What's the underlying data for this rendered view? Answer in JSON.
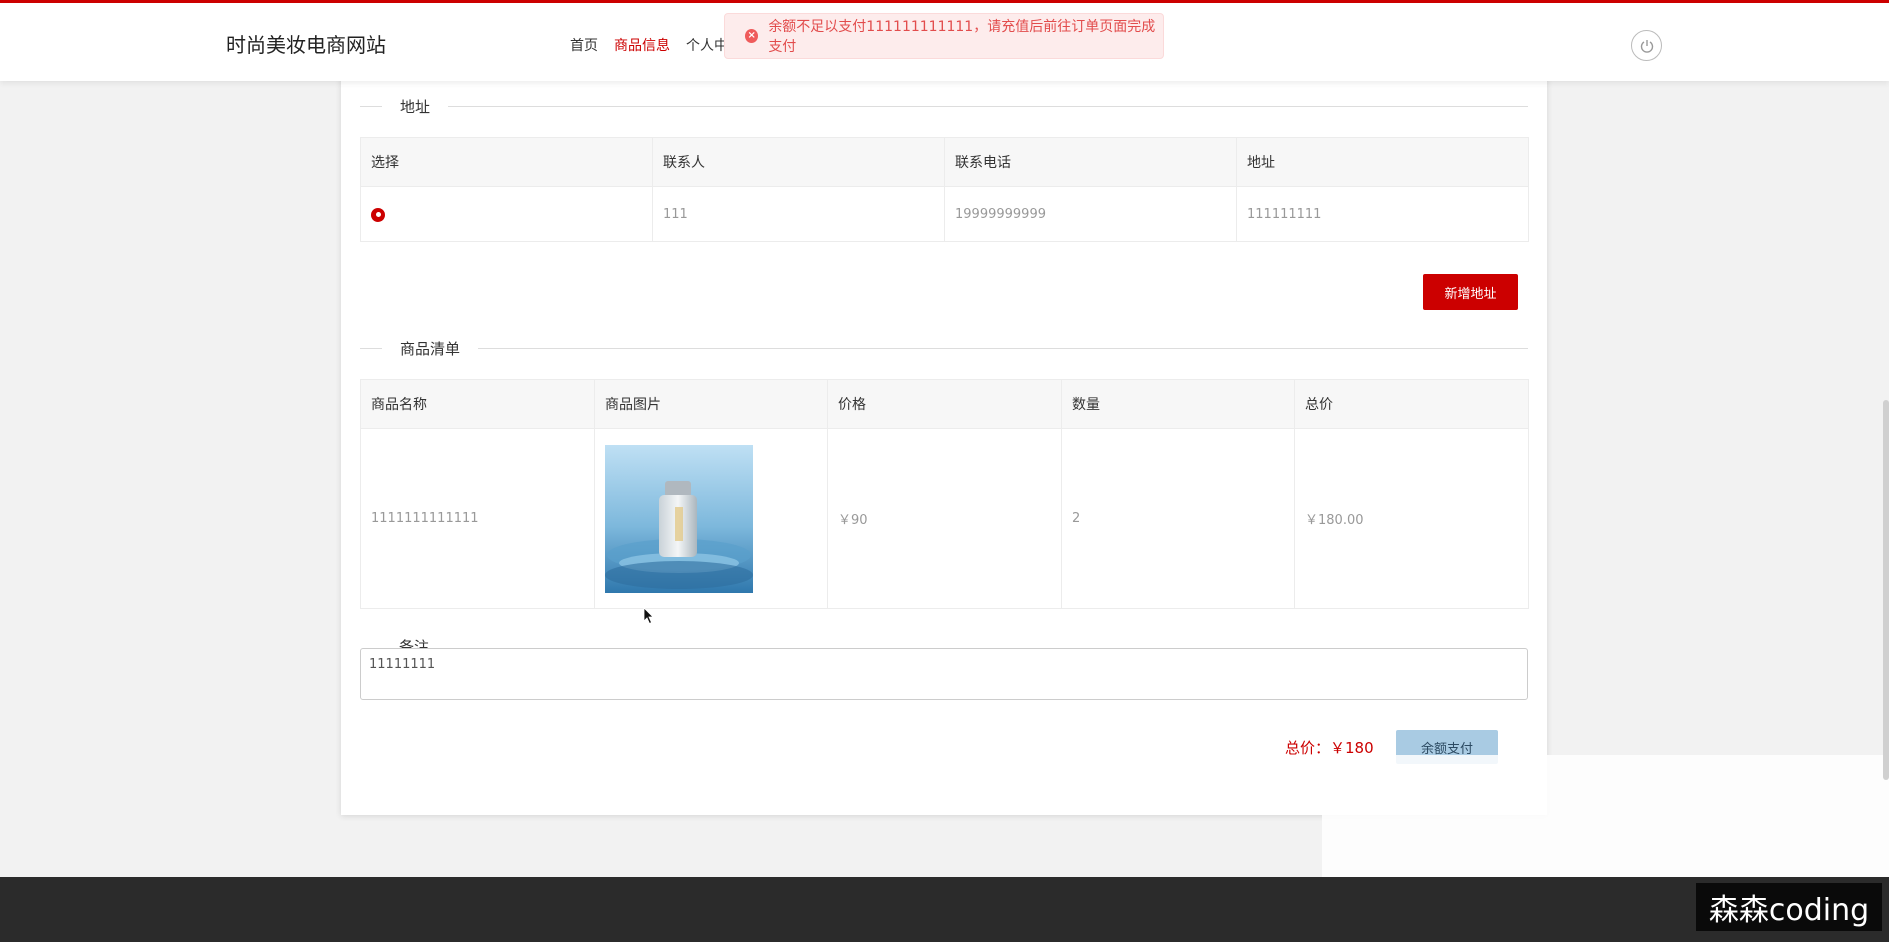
{
  "header": {
    "site_title": "时尚美妆电商网站",
    "nav": [
      {
        "label": "首页",
        "active": false
      },
      {
        "label": "商品信息",
        "active": true
      },
      {
        "label": "个人中",
        "active": false
      }
    ],
    "power_icon": "power-icon"
  },
  "toast": {
    "icon": "error-circle-icon",
    "message": "余额不足以支付111111111111，请充值后前往订单页面完成支付"
  },
  "address": {
    "section_title": "地址",
    "columns": [
      "选择",
      "联系人",
      "联系电话",
      "地址"
    ],
    "rows": [
      {
        "selected": true,
        "contact": "111",
        "phone": "19999999999",
        "address": "111111111"
      }
    ],
    "add_button": "新增地址"
  },
  "products": {
    "section_title": "商品清单",
    "columns": [
      "商品名称",
      "商品图片",
      "价格",
      "数量",
      "总价"
    ],
    "rows": [
      {
        "name": "1111111111111",
        "image": "serum-bottle-image",
        "price": "￥90",
        "qty": "2",
        "total": "￥180.00"
      }
    ]
  },
  "note": {
    "section_title": "备注",
    "value": "11111111"
  },
  "summary": {
    "total_label": "总价：",
    "total_value": "￥180",
    "pay_button": "余额支付"
  },
  "watermark": "森森coding",
  "colors": {
    "brand": "#cc0000",
    "toast_bg": "#fdecec",
    "pay_button": "#a9cbe3",
    "footer": "#2b2b2b"
  }
}
